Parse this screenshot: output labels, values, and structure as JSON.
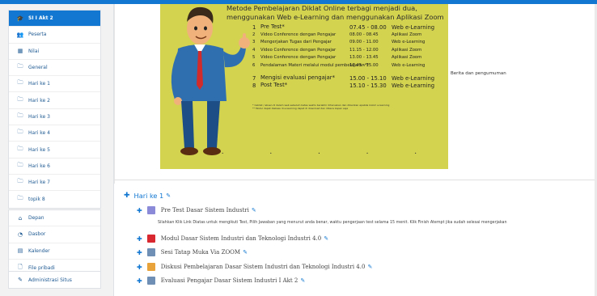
{
  "sidebar": {
    "groups": [
      [
        {
          "label": "SI I Akt 2",
          "icon": "graduation-cap-icon",
          "glyph": "🎓",
          "active": true
        },
        {
          "label": "Peserta",
          "icon": "users-icon",
          "glyph": "👥"
        },
        {
          "label": "Nilai",
          "icon": "table-icon",
          "glyph": "▦"
        },
        {
          "label": "General",
          "icon": "folder-icon",
          "glyph": "🗀"
        },
        {
          "label": "Hari ke 1",
          "icon": "folder-icon",
          "glyph": "🗀"
        },
        {
          "label": "Hari ke 2",
          "icon": "folder-icon",
          "glyph": "🗀"
        },
        {
          "label": "Hari ke 3",
          "icon": "folder-icon",
          "glyph": "🗀"
        },
        {
          "label": "Hari ke 4",
          "icon": "folder-icon",
          "glyph": "🗀"
        },
        {
          "label": "Hari ke 5",
          "icon": "folder-icon",
          "glyph": "🗀"
        },
        {
          "label": "Hari ke 6",
          "icon": "folder-icon",
          "glyph": "🗀"
        },
        {
          "label": "Hari ke 7",
          "icon": "folder-icon",
          "glyph": "🗀"
        },
        {
          "label": "topik 8",
          "icon": "folder-icon",
          "glyph": "🗀"
        }
      ],
      [
        {
          "label": "Depan",
          "icon": "home-icon",
          "glyph": "⌂"
        },
        {
          "label": "Dasbor",
          "icon": "dashboard-icon",
          "glyph": "◔"
        },
        {
          "label": "Kalender",
          "icon": "calendar-icon",
          "glyph": "▤"
        },
        {
          "label": "File pribadi",
          "icon": "file-icon",
          "glyph": "🗋"
        }
      ],
      [
        {
          "label": "Administrasi Situs",
          "icon": "wrench-icon",
          "glyph": "✎"
        }
      ]
    ]
  },
  "poster": {
    "title_line1": "Metode Pembelajaran Diklat Online terbagi menjadi dua,",
    "title_line2": "menggunakan Web e-Learning dan menggunakan Aplikasi Zoom",
    "rows": [
      {
        "num": "1",
        "name": "Pre Test*",
        "time": "07.45  -  08.00",
        "mode": "Web e-Learning",
        "big": true
      },
      {
        "num": "2",
        "name": "Video Conference dengan Pengajar",
        "time": "08.00  -  08.45",
        "mode": "Aplikasi Zoom"
      },
      {
        "num": "3",
        "name": "Mengerjakan Tugas dari Pengajar",
        "time": "09.00  -  11.00",
        "mode": "Web e-Learning"
      },
      {
        "num": "4",
        "name": "Video Conference dengan Pengajar",
        "time": "11.15  -  12.00",
        "mode": "Aplikasi Zoom"
      },
      {
        "num": "5",
        "name": "Video Conference dengan Pengajar",
        "time": "13.00  -  13.45",
        "mode": "Aplikasi Zoom"
      },
      {
        "num": "6",
        "name": "Pendalaman Materi melalui modul pembelajaran**",
        "time": "13.45  -  15.00",
        "mode": "Web e-Learning",
        "tall": true
      },
      {
        "num": "7",
        "name": "Mengisi evaluasi pengajar*",
        "time": "15.00  -  15.10",
        "mode": "Web e-Learning",
        "big": true
      },
      {
        "num": "8",
        "name": "Post Test*",
        "time": "15.10  -  15.30",
        "mode": "Web e-Learning",
        "big": true
      }
    ],
    "footnote1": "* Ceklist / absen di dalam web sebelum batas waktu berakhir diharuskan dan diberikan apabila kolom e-learning",
    "footnote2": "** Modul dapat diakses di e-learning dapat di download dan dibaca kapan saja",
    "dots": "• • • • •"
  },
  "side_note": "Berita dan pengumuman",
  "section": {
    "title": "Hari ke 1"
  },
  "activities": [
    {
      "label": "Pre Test Dasar Sistem Industri",
      "icon": "quiz-icon",
      "color": "#8a8ad8"
    },
    {
      "label": "Modul Dasar Sistem Industri dan Teknologi Industri 4.0",
      "icon": "pdf-icon",
      "color": "#d9282f"
    },
    {
      "label": "Sesi Tatap Muka Via ZOOM",
      "icon": "url-icon",
      "color": "#6f8fb5"
    },
    {
      "label": "Diskusi Pembelajaran Dasar Sistem Industri dan Teknologi Industri 4.0",
      "icon": "forum-icon",
      "color": "#e8a33b"
    },
    {
      "label": "Evaluasi Pengajar Dasar Sistem Industri I Akt 2",
      "icon": "feedback-icon",
      "color": "#6f8fb5"
    }
  ],
  "activity_description": "Silahkan Klik Link Diatas untuk mengikuti Test, Pilih Jawaban yang menurut anda benar, waktu pengerjaan test selama 15 menit. Klik Finish Atempt jika sudah selesai mengerjakan",
  "colors": {
    "accent": "#1177d1",
    "poster_bg": "#d3d34f"
  }
}
